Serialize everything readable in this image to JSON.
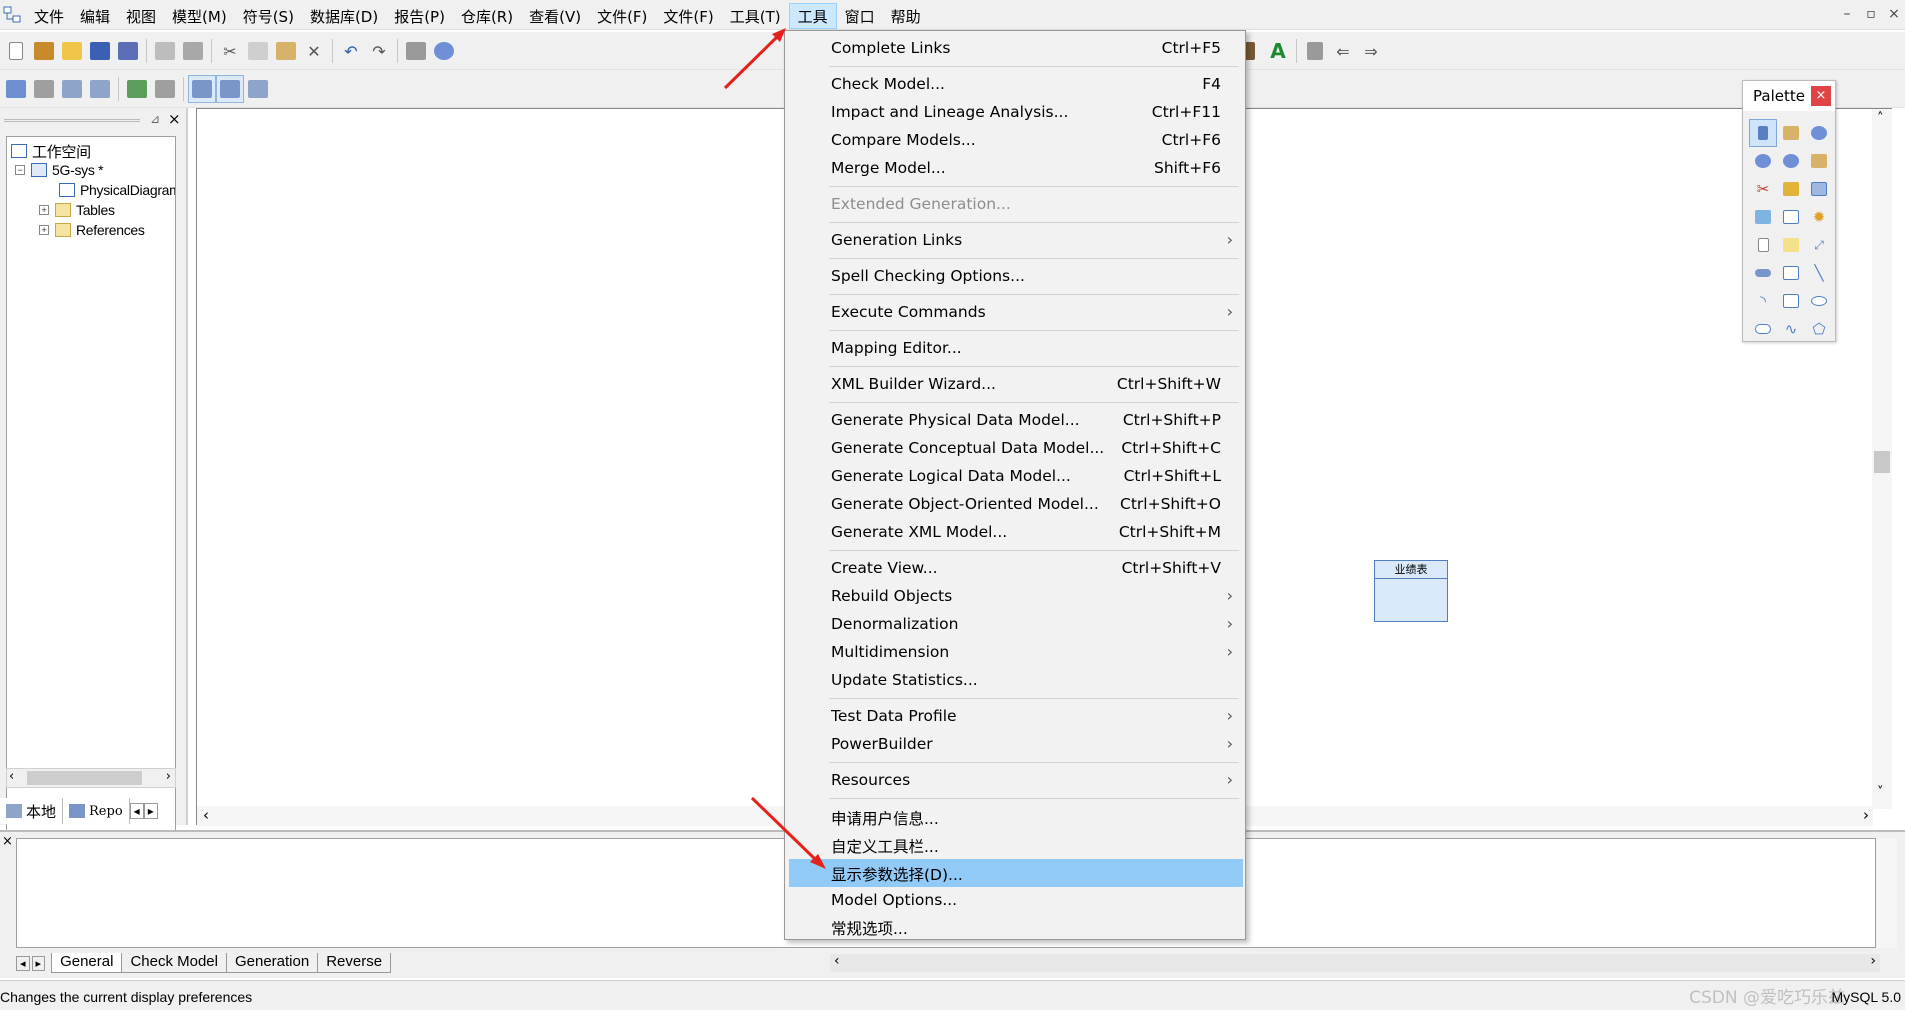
{
  "menubar": {
    "items": [
      {
        "label": "文件"
      },
      {
        "label": "编辑"
      },
      {
        "label": "视图"
      },
      {
        "label": "模型(M)"
      },
      {
        "label": "符号(S)"
      },
      {
        "label": "数据库(D)"
      },
      {
        "label": "报告(P)"
      },
      {
        "label": "仓库(R)"
      },
      {
        "label": "查看(V)"
      },
      {
        "label": "文件(F)"
      },
      {
        "label": "文件(F)"
      },
      {
        "label": "工具(T)"
      },
      {
        "label": "工具"
      },
      {
        "label": "窗口"
      },
      {
        "label": "帮助"
      }
    ],
    "window_buttons": {
      "minimize": "–",
      "restore": "▫",
      "close": "×"
    }
  },
  "tree": {
    "workspace": "工作空间",
    "model": "5G-sys *",
    "diagram": "PhysicalDiagram",
    "tables": "Tables",
    "references": "References"
  },
  "left_tabs": {
    "local": "本地",
    "repository": "Repo"
  },
  "palette": {
    "title": "Palette",
    "close": "×"
  },
  "entity": {
    "title": "业绩表"
  },
  "tools_menu": {
    "items": [
      {
        "label": "Complete Links",
        "shortcut": "Ctrl+F5"
      },
      {
        "label": "Check Model...",
        "shortcut": "F4"
      },
      {
        "label": "Impact and Lineage Analysis...",
        "shortcut": "Ctrl+F11"
      },
      {
        "label": "Compare Models...",
        "shortcut": "Ctrl+F6"
      },
      {
        "label": "Merge Model...",
        "shortcut": "Shift+F6"
      },
      {
        "label": "Extended Generation...",
        "shortcut": ""
      },
      {
        "label": "Generation Links",
        "shortcut": ""
      },
      {
        "label": "Spell Checking Options...",
        "shortcut": ""
      },
      {
        "label": "Execute Commands",
        "shortcut": ""
      },
      {
        "label": "Mapping Editor...",
        "shortcut": ""
      },
      {
        "label": "XML Builder Wizard...",
        "shortcut": "Ctrl+Shift+W"
      },
      {
        "label": "Generate Physical Data Model...",
        "shortcut": "Ctrl+Shift+P"
      },
      {
        "label": "Generate Conceptual Data Model...",
        "shortcut": "Ctrl+Shift+C"
      },
      {
        "label": "Generate Logical Data Model...",
        "shortcut": "Ctrl+Shift+L"
      },
      {
        "label": "Generate Object-Oriented Model...",
        "shortcut": "Ctrl+Shift+O"
      },
      {
        "label": "Generate XML Model...",
        "shortcut": "Ctrl+Shift+M"
      },
      {
        "label": "Create View...",
        "shortcut": "Ctrl+Shift+V"
      },
      {
        "label": "Rebuild Objects",
        "shortcut": ""
      },
      {
        "label": "Denormalization",
        "shortcut": ""
      },
      {
        "label": "Multidimension",
        "shortcut": ""
      },
      {
        "label": "Update Statistics...",
        "shortcut": ""
      },
      {
        "label": "Test Data Profile",
        "shortcut": ""
      },
      {
        "label": "PowerBuilder",
        "shortcut": ""
      },
      {
        "label": "Resources",
        "shortcut": ""
      },
      {
        "label": "申请用户信息...",
        "shortcut": ""
      },
      {
        "label": "自定义工具栏...",
        "shortcut": ""
      },
      {
        "label": "显示参数选择(D)...",
        "shortcut": ""
      },
      {
        "label": "Model Options...",
        "shortcut": ""
      },
      {
        "label": "常规选项...",
        "shortcut": ""
      }
    ]
  },
  "output_tabs": {
    "general": "General",
    "check_model": "Check Model",
    "generation": "Generation",
    "reverse": "Reverse"
  },
  "status": {
    "text": "Changes the current display preferences",
    "db": "MySQL 5.0",
    "watermark": "CSDN @爱吃巧乐兹"
  },
  "colors": {
    "menu_highlight": "#91c9f7",
    "active_menu": "#cce8ff",
    "arrow": "#e8201c"
  }
}
